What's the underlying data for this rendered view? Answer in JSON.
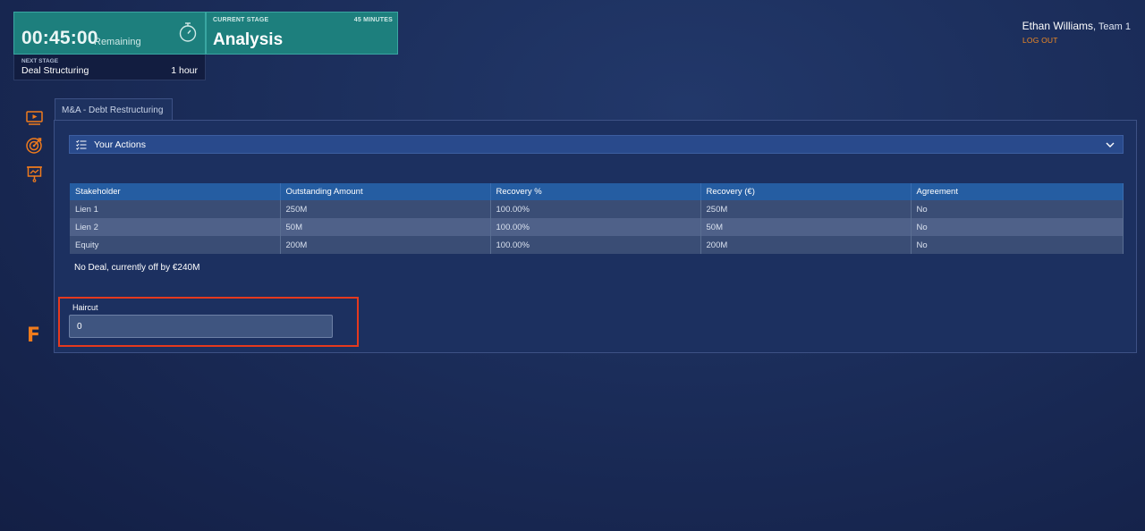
{
  "timer": {
    "value": "00:45:00",
    "label": "Remaining",
    "icon": "stopwatch-icon"
  },
  "current_stage": {
    "label": "CURRENT STAGE",
    "minutes": "45 MINUTES",
    "name": "Analysis"
  },
  "next_stage": {
    "label": "NEXT STAGE",
    "name": "Deal Structuring",
    "duration": "1 hour"
  },
  "user": {
    "name": "Ethan Williams",
    "team": ", Team 1",
    "logout": "LOG OUT"
  },
  "sidebar": {
    "icons": [
      "video-icon",
      "target-icon",
      "presentation-icon"
    ],
    "logo": "F"
  },
  "tab": {
    "label": "M&A - Debt Restructuring"
  },
  "actions": {
    "label": "Your Actions"
  },
  "table": {
    "headers": [
      "Stakeholder",
      "Outstanding Amount",
      "Recovery %",
      "Recovery (€)",
      "Agreement"
    ],
    "rows": [
      [
        "Lien 1",
        "250M",
        "100.00%",
        "250M",
        "No"
      ],
      [
        "Lien 2",
        "50M",
        "100.00%",
        "50M",
        "No"
      ],
      [
        "Equity",
        "200M",
        "100.00%",
        "200M",
        "No"
      ]
    ]
  },
  "deal_status": "No Deal, currently off by €240M",
  "haircut": {
    "label": "Haircut",
    "value": "0"
  },
  "colors": {
    "accent_orange": "#f07b1c",
    "teal": "#1d7f7d",
    "highlight_red": "#e5391e",
    "header_blue": "#255da2"
  }
}
